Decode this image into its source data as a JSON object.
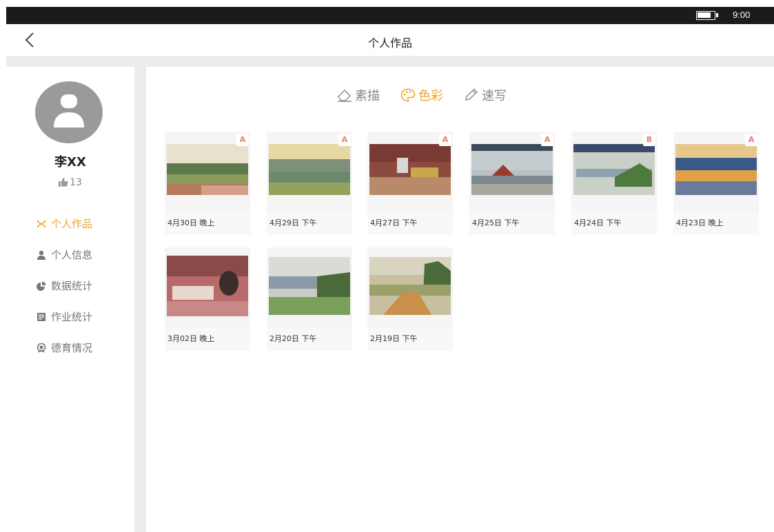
{
  "status": {
    "time": "9:00"
  },
  "header": {
    "title": "个人作品"
  },
  "profile": {
    "name": "李XX",
    "likes": "13"
  },
  "sidebar": {
    "items": [
      {
        "label": "个人作品",
        "icon": "works-icon",
        "active": true
      },
      {
        "label": "个人信息",
        "icon": "person-icon",
        "active": false
      },
      {
        "label": "数据统计",
        "icon": "pie-chart-icon",
        "active": false
      },
      {
        "label": "作业统计",
        "icon": "homework-icon",
        "active": false
      },
      {
        "label": "德育情况",
        "icon": "medal-icon",
        "active": false
      }
    ]
  },
  "tabs": [
    {
      "label": "素描",
      "icon": "eraser-icon",
      "active": false
    },
    {
      "label": "色彩",
      "icon": "palette-icon",
      "active": true
    },
    {
      "label": "速写",
      "icon": "pencil-icon",
      "active": false
    }
  ],
  "artworks": [
    {
      "date": "4月30日 晚上",
      "grade": "A"
    },
    {
      "date": "4月29日 下午",
      "grade": "A"
    },
    {
      "date": "4月27日 下午",
      "grade": "A"
    },
    {
      "date": "4月25日 下午",
      "grade": "A"
    },
    {
      "date": "4月24日 下午",
      "grade": "B"
    },
    {
      "date": "4月23日 晚上",
      "grade": "A"
    },
    {
      "date": "3月02日 晚上",
      "grade": ""
    },
    {
      "date": "2月20日 下午",
      "grade": ""
    },
    {
      "date": "2月19日 下午",
      "grade": ""
    }
  ],
  "colors": {
    "accent": "#f0a22a",
    "grade": "#e87d72",
    "statusbar": "#1f1a1a"
  }
}
